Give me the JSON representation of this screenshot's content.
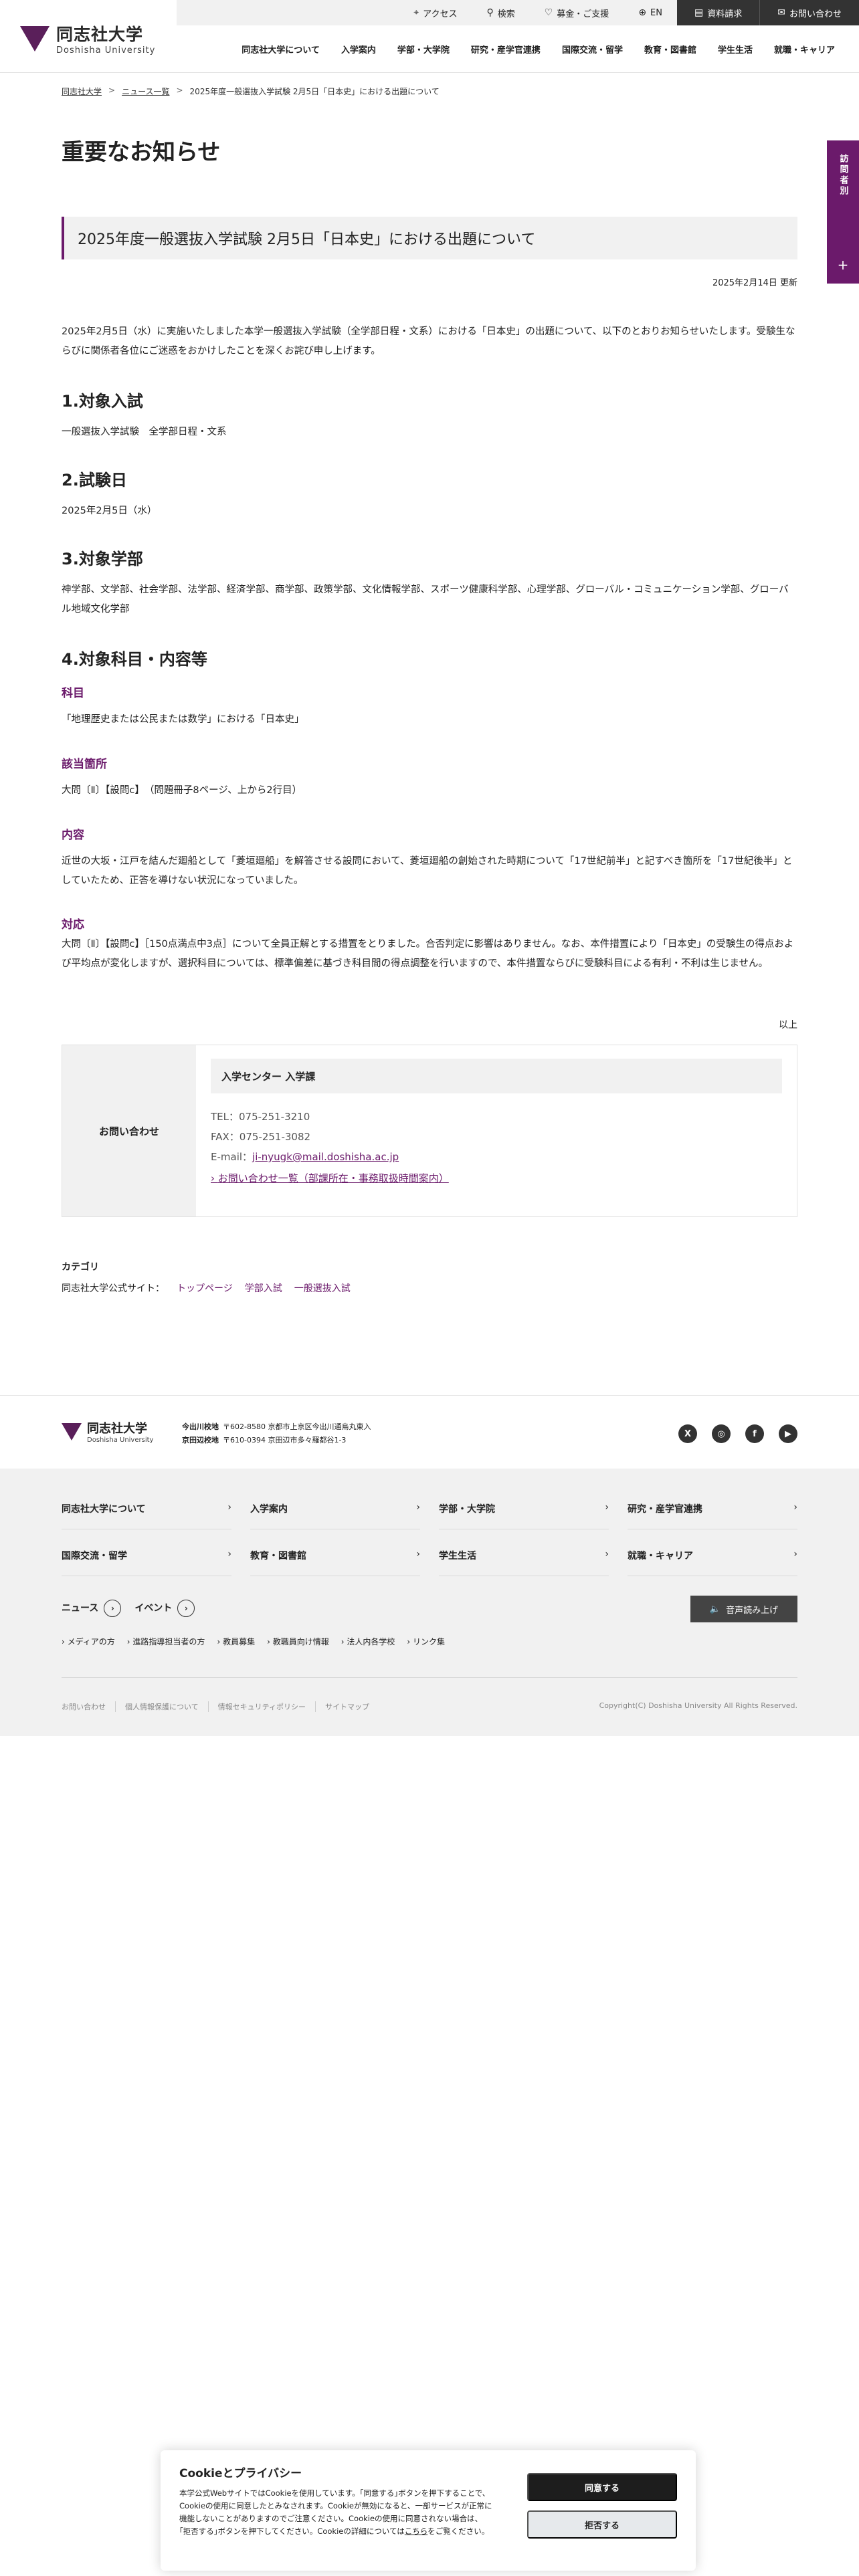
{
  "header": {
    "logo_ja": "同志社大学",
    "logo_en": "Doshisha University",
    "util": {
      "access": "アクセス",
      "search": "検索",
      "donation": "募金・ご支援",
      "lang": "EN",
      "request": "資料請求",
      "contact": "お問い合わせ"
    },
    "gnav": [
      "同志社大学について",
      "入学案内",
      "学部・大学院",
      "研究・産学官連携",
      "国際交流・留学",
      "教育・図書館",
      "学生生活",
      "就職・キャリア"
    ]
  },
  "breadcrumb": {
    "home": "同志社大学",
    "news": "ニュース一覧",
    "current": "2025年度一般選抜入学試験 2月5日「日本史」における出題について",
    "separator": ">"
  },
  "side_tab": {
    "label": "訪問者別",
    "plus": "+"
  },
  "page_title": "重要なお知らせ",
  "article": {
    "title": "2025年度一般選抜入学試験 2月5日「日本史」における出題について",
    "updated": "2025年2月14日 更新",
    "intro": "2025年2月5日（水）に実施いたしました本学一般選抜入学試験（全学部日程・文系）における「日本史」の出題について、以下のとおりお知らせいたします。受験生ならびに関係者各位にご迷惑をおかけしたことを深くお詫び申し上げます。",
    "s1_title": "1.対象入試",
    "s1_text": "一般選抜入学試験　全学部日程・文系",
    "s2_title": "2.試験日",
    "s2_text": "2025年2月5日（水）",
    "s3_title": "3.対象学部",
    "s3_text": "神学部、文学部、社会学部、法学部、経済学部、商学部、政策学部、文化情報学部、スポーツ健康科学部、心理学部、グローバル・コミュニケーション学部、グローバル地域文化学部",
    "s4_title": "4.対象科目・内容等",
    "sub1_title": "科目",
    "sub1_text": "「地理歴史または公民または数学」における「日本史」",
    "sub2_title": "該当箇所",
    "sub2_text": "大問〔Ⅱ〕【設問c】　（問題冊子8ページ、上から2行目）",
    "sub3_title": "内容",
    "sub3_text": "近世の大坂・江戸を結んだ廻船として「菱垣廻船」を解答させる設問において、菱垣廻船の創始された時期について「17世紀前半」と記すべき箇所を「17世紀後半」としていたため、正答を導けない状況になっていました。",
    "sub4_title": "対応",
    "sub4_text": "大問〔Ⅱ〕【設問c】［150点満点中3点］について全員正解とする措置をとりました。合否判定に影響はありません。なお、本件措置により「日本史」の受験生の得点および平均点が変化しますが、選択科目については、標準偏差に基づき科目間の得点調整を行いますので、本件措置ならびに受験科目による有利・不利は生じません。",
    "end": "以上"
  },
  "contact_box": {
    "label": "お問い合わせ",
    "dept": "入学センター 入学課",
    "tel": "TEL：075-251-3210",
    "fax": "FAX：075-251-3082",
    "email_label": "E-mail：",
    "email": "ji-nyugk@mail.doshisha.ac.jp",
    "link": "お問い合わせ一覧（部課所在・事務取扱時間案内）"
  },
  "category": {
    "title": "カテゴリ",
    "label": "同志社大学公式サイト：",
    "links": [
      "トップページ",
      "学部入試",
      "一般選抜入試"
    ]
  },
  "footer": {
    "campus1_name": "今出川校地",
    "campus1_addr": "〒602-8580 京都市上京区今出川通烏丸東入",
    "campus2_name": "京田辺校地",
    "campus2_addr": "〒610-0394 京田辺市多々羅都谷1-3",
    "sns": [
      "X",
      "◎",
      "f",
      "▶"
    ],
    "nav_row1": [
      "同志社大学について",
      "入学案内",
      "学部・大学院",
      "研究・産学官連携"
    ],
    "nav_row2": [
      "国際交流・留学",
      "教育・図書館",
      "学生生活",
      "就職・キャリア"
    ],
    "news": "ニュース",
    "events": "イベント",
    "voice": "音声読み上げ",
    "sub_links": [
      "メディアの方",
      "進路指導担当者の方",
      "教員募集",
      "教職員向け情報",
      "法人内各学校",
      "リンク集"
    ],
    "legal": [
      "お問い合わせ",
      "個人情報保護について",
      "情報セキュリティポリシー",
      "サイトマップ"
    ],
    "copyright": "Copyright(C) Doshisha University All Rights Reserved."
  },
  "cookie": {
    "title": "Cookieとプライバシー",
    "text": "本学公式WebサイトではCookieを使用しています。｢同意する｣ボタンを押下することで、Cookieの使用に同意したとみなされます。Cookieが無効になると、一部サービスが正常に機能しないことがありますのでご注意ください。Cookieの使用に同意されない場合は、｢拒否する｣ボタンを押下してください。Cookieの詳細については",
    "link": "こちら",
    "text_after": "をご覧ください。",
    "agree": "同意する",
    "refuse": "拒否する"
  }
}
